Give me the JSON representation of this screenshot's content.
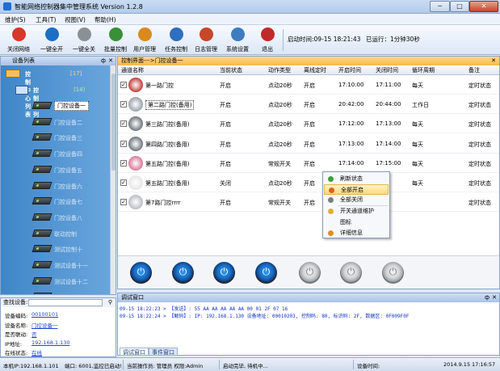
{
  "window": {
    "title": "智能网络控制器集中管理系统  Version 1.2.8",
    "minimize": "─",
    "maximize": "□",
    "close": "✕"
  },
  "menu": [
    "维护(S)",
    "工具(T)",
    "视图(V)",
    "帮助(H)"
  ],
  "toolbar": {
    "buttons": [
      {
        "label": "关闭网络",
        "icon": "close-network-icon",
        "color": "#d9362a"
      },
      {
        "label": "一键全开",
        "icon": "power-on-icon",
        "color": "#1b6fc4"
      },
      {
        "label": "一键全关",
        "icon": "power-off-icon",
        "color": "#8b9097"
      },
      {
        "label": "批量控制",
        "icon": "batch-control-icon",
        "color": "#3a8f3a"
      },
      {
        "label": "用户管理",
        "icon": "user-management-icon",
        "color": "#d88b1c"
      },
      {
        "label": "任务控制",
        "icon": "task-control-icon",
        "color": "#2f6fbf"
      },
      {
        "label": "日志管理",
        "icon": "log-management-icon",
        "color": "#c7472b"
      },
      {
        "label": "系统设置",
        "icon": "system-settings-icon",
        "color": "#3d7cc0"
      },
      {
        "label": "退出",
        "icon": "exit-icon",
        "color": "#c12a2a"
      }
    ],
    "start_time": "启动时间:09-15 18:21:43",
    "uptime": "已运行：1分钟30秒"
  },
  "device_list": {
    "title": "设备列表",
    "root": {
      "label": "控制中心列表",
      "count": "[17]"
    },
    "group": {
      "label": "控制器列表",
      "count": "(14)"
    },
    "devices": [
      "门控设备一",
      "门控设备二",
      "门控设备三",
      "门控设备四",
      "门控设备五",
      "门控设备六",
      "门控设备七",
      "门控设备八",
      "联动控制",
      "测试控制十",
      "测试设备十一",
      "测试设备十二",
      "测试设备十三"
    ]
  },
  "properties": {
    "search_label": "查找设备:",
    "items": [
      {
        "key": "设备编码:",
        "value": "00100101"
      },
      {
        "key": "设备名称:",
        "value": "门控设备一"
      },
      {
        "key": "是否联动:",
        "value": "否"
      },
      {
        "key": "IP地址:",
        "value": "192.168.1.130"
      },
      {
        "key": "在线状态:",
        "value": "在线"
      }
    ]
  },
  "control_panel": {
    "tab": "控制界面--->门控设备一",
    "columns": [
      "通道名称",
      "当前状态",
      "动作类型",
      "离线定时",
      "开启时间",
      "关闭时间",
      "循环周期",
      "备注"
    ],
    "rows": [
      {
        "name": "第一路门控",
        "state": "开启",
        "action": "点动20秒",
        "offline": "开启",
        "on": "17:10:00",
        "off": "17:11:00",
        "cycle": "每天",
        "note": "定时状态",
        "checked": true,
        "icon_color": "#c23b3b"
      },
      {
        "name": "第二路门控(备用)",
        "state": "开启",
        "action": "点动20秒",
        "offline": "开启",
        "on": "20:42:00",
        "off": "20:44:00",
        "cycle": "工作日",
        "note": "定时状态",
        "checked": true,
        "icon_color": "#9aa3ad"
      },
      {
        "name": "第三路门控(备用)",
        "state": "开启",
        "action": "点动20秒",
        "offline": "开启",
        "on": "17:12:00",
        "off": "17:13:00",
        "cycle": "每天",
        "note": "定时状态",
        "checked": true,
        "icon_color": "#6f767d"
      },
      {
        "name": "第四路门控(备用)",
        "state": "开启",
        "action": "点动20秒",
        "offline": "开启",
        "on": "17:13:00",
        "off": "17:14:00",
        "cycle": "每天",
        "note": "定时状态",
        "checked": true,
        "icon_color": "#6f767d"
      },
      {
        "name": "第五路门控(备用)",
        "state": "开启",
        "action": "常规开关",
        "offline": "开启",
        "on": "17:14:00",
        "off": "17:15:00",
        "cycle": "每天",
        "note": "定时状态",
        "checked": true,
        "icon_color": "#d77a9a"
      },
      {
        "name": "第五路门控(备用)",
        "state": "关闭",
        "action": "点动20秒",
        "offline": "开启",
        "on": "",
        "off": "",
        "cycle": "每天",
        "note": "定时状态",
        "checked": true,
        "icon_color": "#e6e6e6"
      },
      {
        "name": "第7路门控rrrr",
        "state": "开启",
        "action": "常规开关",
        "offline": "开启",
        "on": "",
        "off": "",
        "cycle": "",
        "note": "定时状态",
        "checked": true,
        "icon_color": "#b9bec4"
      }
    ],
    "power_states": [
      "on",
      "on",
      "on",
      "on",
      "off",
      "off",
      "off"
    ]
  },
  "context_menu": {
    "items": [
      {
        "label": "刷新状态",
        "icon": "refresh-icon",
        "color": "#3aa03a"
      },
      {
        "label": "全部开启",
        "icon": "all-on-icon",
        "color": "#e0601f"
      },
      {
        "label": "全部关闭",
        "icon": "all-off-icon",
        "color": "#7a7f86"
      },
      {
        "label": "开关通道维护",
        "icon": "maintenance-icon",
        "color": "#e0b22a"
      },
      {
        "label": "图标",
        "icon": "icon-icon",
        "color": ""
      },
      {
        "label": "详细信息",
        "icon": "check-icon",
        "color": "#e08f1a"
      }
    ]
  },
  "debug": {
    "title": "调试窗口",
    "lines": [
      "09-15 18:22:23 > 【发送】: 55 AA AA AA AA AA 00 01 2F 07 16",
      "09-15 18:22:24 > 【解码】: IP: 192.168.1.130 设备地址: 00010203, 控制码: 80, 标识码: 2F, 数据区: 0F009F0F"
    ],
    "tabs": [
      "调试窗口",
      "事件窗口"
    ]
  },
  "status": {
    "local_ip": "本机IP:192.168.1.101",
    "port": "端口: 6001,监控已启动!",
    "operator": "当前操作员: 管理员  权限:Admin",
    "login": "启动完毕, 待机中...",
    "device_info": "设备时间:",
    "date": "2014.9.15",
    "time": "17:16:57"
  }
}
